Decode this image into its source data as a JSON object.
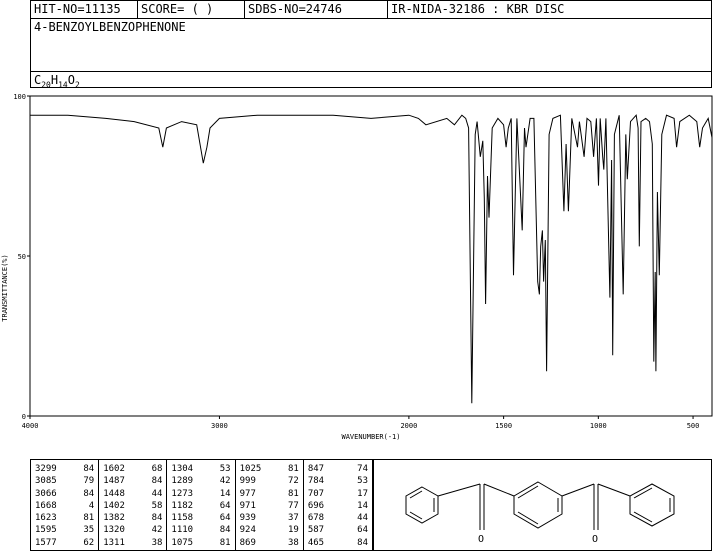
{
  "header": {
    "hit_no": "HIT-NO=11135",
    "score": "SCORE=  (   )",
    "sdbs_no": "SDBS-NO=24746",
    "ir_nida": "IR-NIDA-32186 : KBR DISC",
    "compound": "4-BENZOYLBENZOPHENONE",
    "formula_parts": [
      "C",
      "20",
      "H",
      "14",
      "O",
      "2"
    ]
  },
  "chart_data": {
    "type": "line",
    "title": "",
    "xlabel": "WAVENUMBER(-1)",
    "ylabel": "TRANSMITTANCE(%)",
    "xlim": [
      4000,
      400
    ],
    "ylim": [
      0,
      100
    ],
    "x_ticks": [
      4000,
      3000,
      2000,
      1500,
      1000,
      500
    ],
    "y_ticks": [
      0,
      50,
      100
    ],
    "series": [
      {
        "points": [
          [
            4000,
            94
          ],
          [
            3800,
            94
          ],
          [
            3600,
            93
          ],
          [
            3450,
            92
          ],
          [
            3320,
            90
          ],
          [
            3299,
            84
          ],
          [
            3280,
            90
          ],
          [
            3200,
            92
          ],
          [
            3120,
            91
          ],
          [
            3085,
            79
          ],
          [
            3066,
            84
          ],
          [
            3050,
            90
          ],
          [
            3000,
            93
          ],
          [
            2800,
            94
          ],
          [
            2600,
            94
          ],
          [
            2400,
            94
          ],
          [
            2200,
            93
          ],
          [
            2000,
            94
          ],
          [
            1950,
            93
          ],
          [
            1910,
            91
          ],
          [
            1800,
            93
          ],
          [
            1760,
            91
          ],
          [
            1720,
            94
          ],
          [
            1700,
            93
          ],
          [
            1685,
            90
          ],
          [
            1668,
            4
          ],
          [
            1650,
            88
          ],
          [
            1640,
            92
          ],
          [
            1623,
            81
          ],
          [
            1610,
            86
          ],
          [
            1602,
            68
          ],
          [
            1595,
            35
          ],
          [
            1585,
            75
          ],
          [
            1577,
            62
          ],
          [
            1560,
            90
          ],
          [
            1530,
            93
          ],
          [
            1500,
            91
          ],
          [
            1487,
            84
          ],
          [
            1475,
            90
          ],
          [
            1460,
            93
          ],
          [
            1448,
            44
          ],
          [
            1430,
            93
          ],
          [
            1402,
            58
          ],
          [
            1390,
            90
          ],
          [
            1382,
            84
          ],
          [
            1360,
            93
          ],
          [
            1340,
            93
          ],
          [
            1320,
            42
          ],
          [
            1311,
            38
          ],
          [
            1304,
            53
          ],
          [
            1295,
            58
          ],
          [
            1289,
            42
          ],
          [
            1280,
            55
          ],
          [
            1273,
            14
          ],
          [
            1260,
            88
          ],
          [
            1240,
            93
          ],
          [
            1200,
            94
          ],
          [
            1182,
            64
          ],
          [
            1170,
            85
          ],
          [
            1158,
            64
          ],
          [
            1140,
            93
          ],
          [
            1110,
            84
          ],
          [
            1100,
            92
          ],
          [
            1075,
            81
          ],
          [
            1060,
            93
          ],
          [
            1040,
            92
          ],
          [
            1025,
            81
          ],
          [
            1010,
            93
          ],
          [
            999,
            72
          ],
          [
            990,
            93
          ],
          [
            977,
            81
          ],
          [
            971,
            77
          ],
          [
            960,
            93
          ],
          [
            939,
            37
          ],
          [
            930,
            80
          ],
          [
            924,
            19
          ],
          [
            915,
            88
          ],
          [
            890,
            94
          ],
          [
            869,
            38
          ],
          [
            855,
            88
          ],
          [
            847,
            74
          ],
          [
            830,
            92
          ],
          [
            800,
            94
          ],
          [
            790,
            90
          ],
          [
            784,
            53
          ],
          [
            775,
            92
          ],
          [
            750,
            93
          ],
          [
            730,
            92
          ],
          [
            715,
            85
          ],
          [
            707,
            17
          ],
          [
            700,
            45
          ],
          [
            696,
            14
          ],
          [
            688,
            70
          ],
          [
            678,
            44
          ],
          [
            665,
            88
          ],
          [
            640,
            94
          ],
          [
            600,
            93
          ],
          [
            587,
            84
          ],
          [
            570,
            92
          ],
          [
            520,
            94
          ],
          [
            480,
            92
          ],
          [
            465,
            84
          ],
          [
            450,
            90
          ],
          [
            420,
            93
          ],
          [
            400,
            87
          ]
        ]
      }
    ]
  },
  "peak_table": [
    [
      [
        "3299",
        "84"
      ],
      [
        "3085",
        "79"
      ],
      [
        "3066",
        "84"
      ],
      [
        "1668",
        "4"
      ],
      [
        "1623",
        "81"
      ],
      [
        "1595",
        "35"
      ],
      [
        "1577",
        "62"
      ]
    ],
    [
      [
        "1602",
        "68"
      ],
      [
        "1487",
        "84"
      ],
      [
        "1448",
        "44"
      ],
      [
        "1402",
        "58"
      ],
      [
        "1382",
        "84"
      ],
      [
        "1320",
        "42"
      ],
      [
        "1311",
        "38"
      ]
    ],
    [
      [
        "1304",
        "53"
      ],
      [
        "1289",
        "42"
      ],
      [
        "1273",
        "14"
      ],
      [
        "1182",
        "64"
      ],
      [
        "1158",
        "64"
      ],
      [
        "1110",
        "84"
      ],
      [
        "1075",
        "81"
      ]
    ],
    [
      [
        "1025",
        "81"
      ],
      [
        "999",
        "72"
      ],
      [
        "977",
        "81"
      ],
      [
        "971",
        "77"
      ],
      [
        "939",
        "37"
      ],
      [
        "924",
        "19"
      ],
      [
        "869",
        "38"
      ]
    ],
    [
      [
        "847",
        "74"
      ],
      [
        "784",
        "53"
      ],
      [
        "707",
        "17"
      ],
      [
        "696",
        "14"
      ],
      [
        "678",
        "44"
      ],
      [
        "587",
        "64"
      ],
      [
        "465",
        "84"
      ]
    ]
  ],
  "structure": {
    "oxygen_label": "O"
  }
}
